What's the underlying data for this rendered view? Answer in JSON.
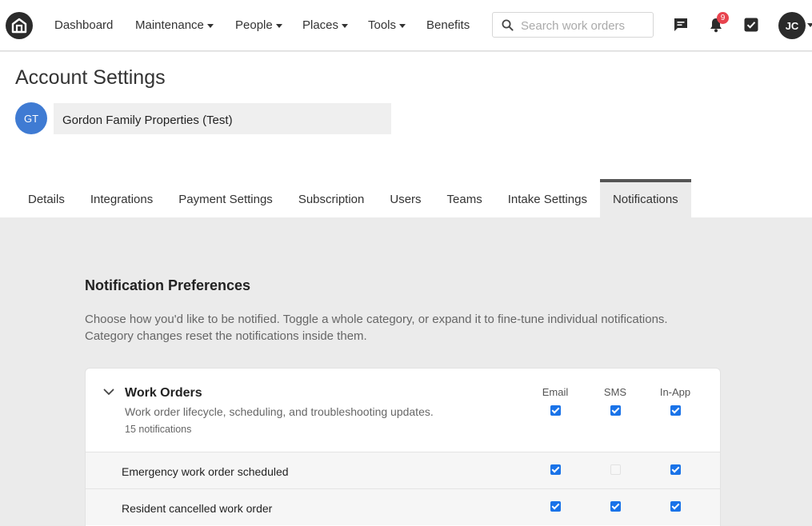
{
  "nav": {
    "items": [
      {
        "label": "Dashboard",
        "dropdown": false
      },
      {
        "label": "Maintenance",
        "dropdown": true
      },
      {
        "label": "People",
        "dropdown": true
      },
      {
        "label": "Places",
        "dropdown": true
      },
      {
        "label": "Tools",
        "dropdown": true
      },
      {
        "label": "Benefits",
        "dropdown": false
      }
    ],
    "search_placeholder": "Search work orders",
    "notification_count": "9",
    "user_initials": "JC"
  },
  "header": {
    "title": "Account Settings",
    "org_initials": "GT",
    "org_name": "Gordon Family Properties (Test)"
  },
  "tabs": [
    {
      "label": "Details",
      "active": false
    },
    {
      "label": "Integrations",
      "active": false
    },
    {
      "label": "Payment Settings",
      "active": false
    },
    {
      "label": "Subscription",
      "active": false
    },
    {
      "label": "Users",
      "active": false
    },
    {
      "label": "Teams",
      "active": false
    },
    {
      "label": "Intake Settings",
      "active": false
    },
    {
      "label": "Notifications",
      "active": true
    }
  ],
  "preferences": {
    "title": "Notification Preferences",
    "description": "Choose how you'd like to be notified. Toggle a whole category, or expand it to fine-tune individual notifications. Category changes reset the notifications inside them.",
    "columns": [
      "Email",
      "SMS",
      "In-App"
    ],
    "category": {
      "title": "Work Orders",
      "description": "Work order lifecycle, scheduling, and troubleshooting updates.",
      "count_label": "15 notifications",
      "email": true,
      "sms": true,
      "in_app": true
    },
    "rows": [
      {
        "label": "Emergency work order scheduled",
        "email": true,
        "sms": "disabled",
        "in_app": true
      },
      {
        "label": "Resident cancelled work order",
        "email": true,
        "sms": true,
        "in_app": true
      }
    ]
  },
  "colors": {
    "accent": "#1a73e8",
    "badge": "#e8434e",
    "org_avatar": "#3f7bd3",
    "nav_dark": "#2b2b2b"
  }
}
